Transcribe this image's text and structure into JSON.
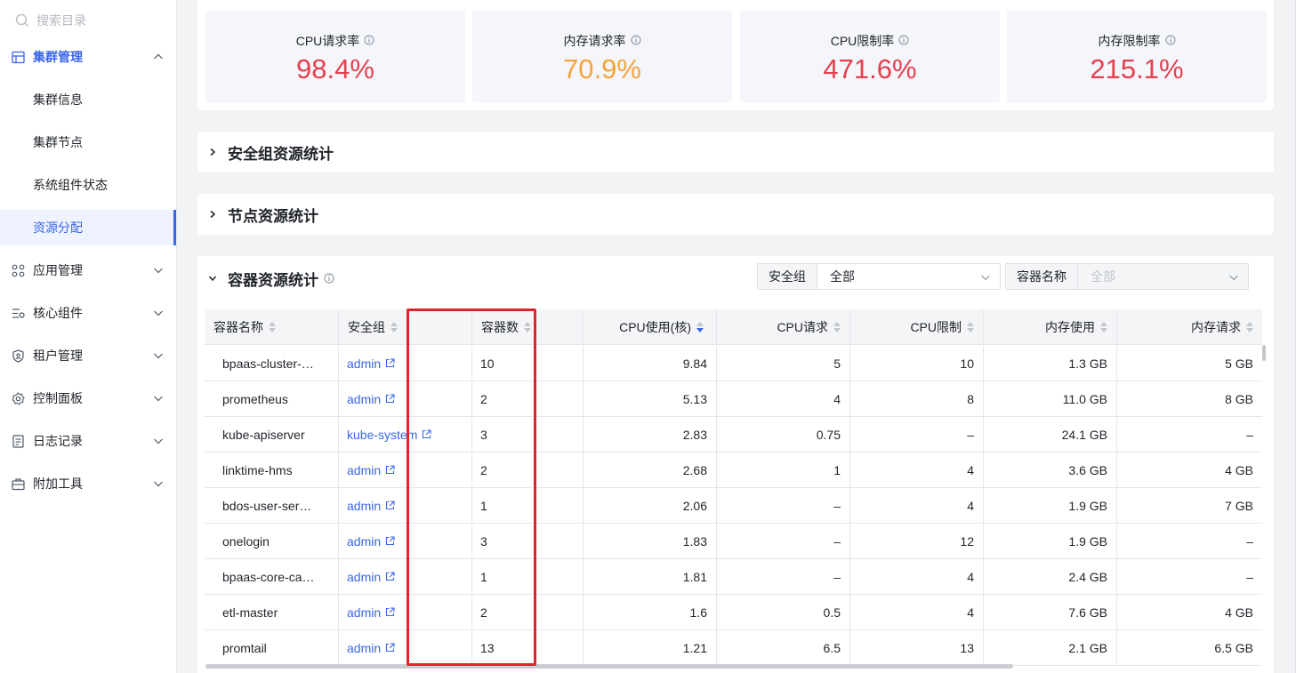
{
  "sidebar": {
    "search_placeholder": "搜索目录",
    "items": [
      {
        "label": "集群管理"
      },
      {
        "label": "集群信息"
      },
      {
        "label": "集群节点"
      },
      {
        "label": "系统组件状态"
      },
      {
        "label": "资源分配"
      },
      {
        "label": "应用管理"
      },
      {
        "label": "核心组件"
      },
      {
        "label": "租户管理"
      },
      {
        "label": "控制面板"
      },
      {
        "label": "日志记录"
      },
      {
        "label": "附加工具"
      }
    ]
  },
  "stats": [
    {
      "label": "CPU请求率",
      "value": "98.4%",
      "color": "#e5404f"
    },
    {
      "label": "内存请求率",
      "value": "70.9%",
      "color": "#f5a33c"
    },
    {
      "label": "CPU限制率",
      "value": "471.6%",
      "color": "#e5404f"
    },
    {
      "label": "内存限制率",
      "value": "215.1%",
      "color": "#e5404f"
    }
  ],
  "sections": {
    "security_group": "安全组资源统计",
    "node": "节点资源统计",
    "container": "容器资源统计"
  },
  "filters": {
    "security_group": {
      "label": "安全组",
      "value": "全部"
    },
    "container_name": {
      "label": "容器名称",
      "value": "全部"
    }
  },
  "table": {
    "headers": [
      "容器名称",
      "安全组",
      "容器数",
      "CPU使用(核)",
      "CPU请求",
      "CPU限制",
      "内存使用",
      "内存请求"
    ],
    "rows": [
      [
        "bpaas-cluster-…",
        "admin",
        "10",
        "9.84",
        "5",
        "10",
        "1.3 GB",
        "5 GB"
      ],
      [
        "prometheus",
        "admin",
        "2",
        "5.13",
        "4",
        "8",
        "11.0 GB",
        "8 GB"
      ],
      [
        "kube-apiserver",
        "kube-system",
        "3",
        "2.83",
        "0.75",
        "–",
        "24.1 GB",
        "–"
      ],
      [
        "linktime-hms",
        "admin",
        "2",
        "2.68",
        "1",
        "4",
        "3.6 GB",
        "4 GB"
      ],
      [
        "bdos-user-ser…",
        "admin",
        "1",
        "2.06",
        "–",
        "4",
        "1.9 GB",
        "7 GB"
      ],
      [
        "onelogin",
        "admin",
        "3",
        "1.83",
        "–",
        "12",
        "1.9 GB",
        "–"
      ],
      [
        "bpaas-core-ca…",
        "admin",
        "1",
        "1.81",
        "–",
        "4",
        "2.4 GB",
        "–"
      ],
      [
        "etl-master",
        "admin",
        "2",
        "1.6",
        "0.5",
        "4",
        "7.6 GB",
        "4 GB"
      ],
      [
        "promtail",
        "admin",
        "13",
        "1.21",
        "6.5",
        "13",
        "2.1 GB",
        "6.5 GB"
      ]
    ]
  },
  "colors": {
    "accent": "#3a66e8",
    "danger": "#e5404f",
    "warning": "#f5a33c",
    "highlight_box": "#e0232c"
  }
}
